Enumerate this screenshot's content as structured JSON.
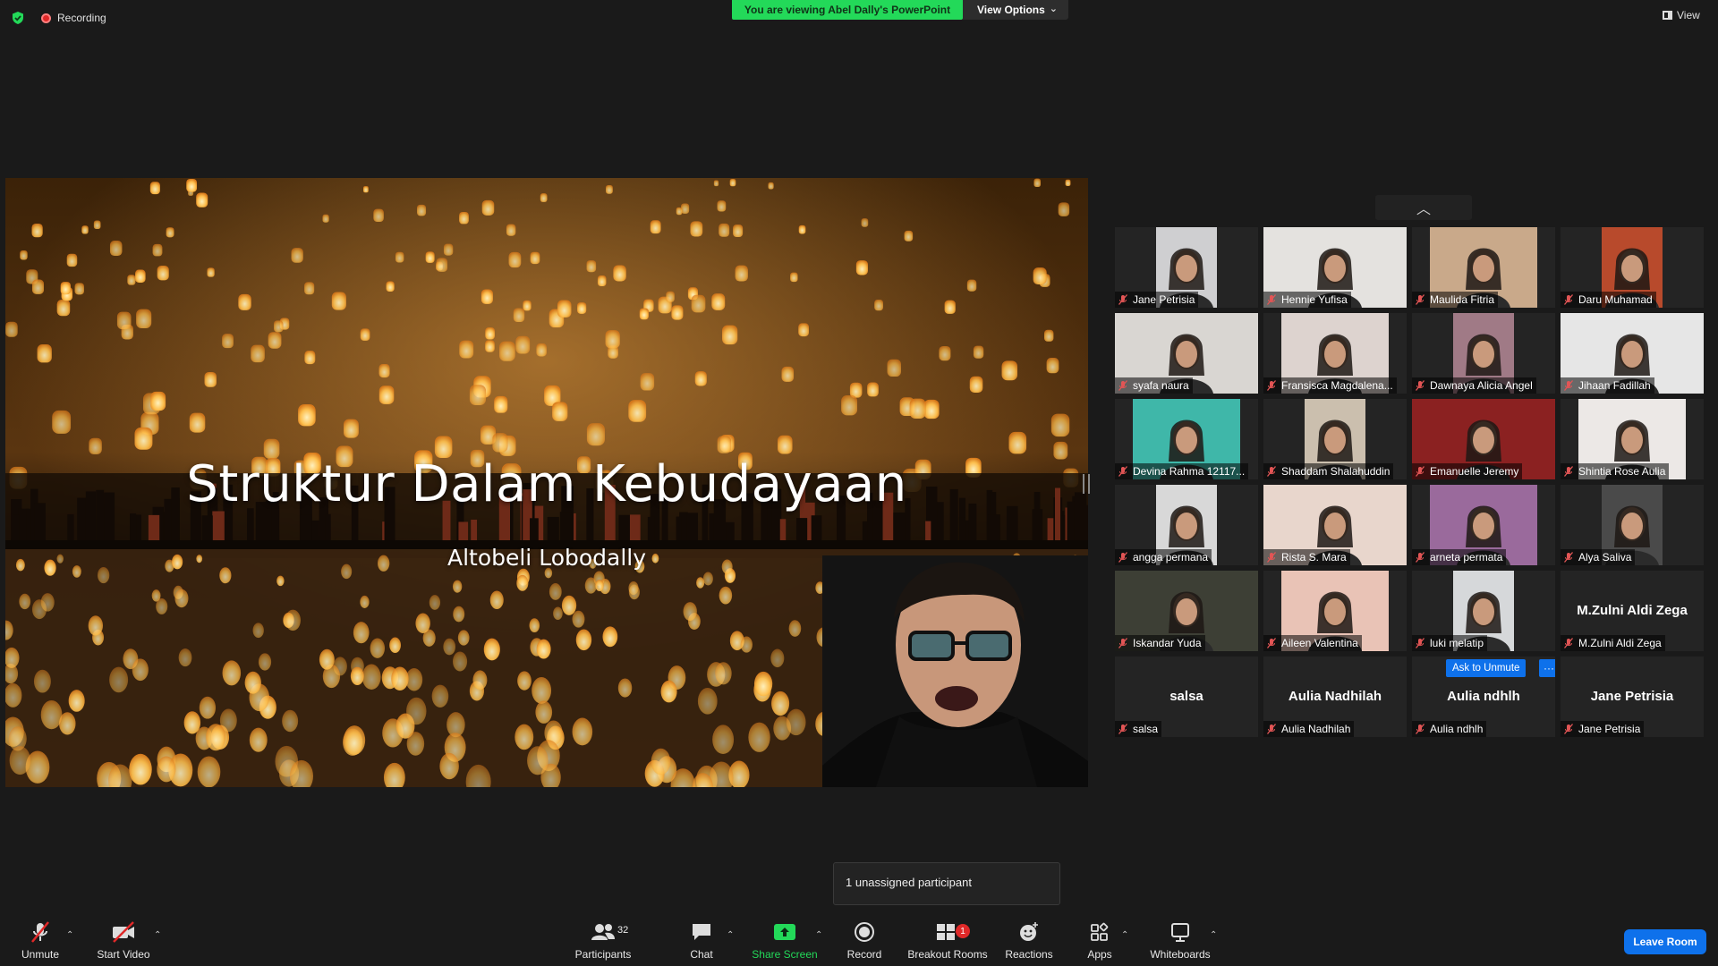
{
  "topbar": {
    "recording_label": "Recording",
    "viewing_banner": "You are viewing Abel Dally's PowerPoint",
    "view_options_label": "View Options",
    "view_label": "View"
  },
  "slide": {
    "title": "Struktur Dalam Kebudayaan",
    "subtitle": "Altobeli Lobodally"
  },
  "gallery": {
    "tiles": [
      {
        "name": "Jane Petrisia",
        "video": true,
        "bg": "#cfcfd1"
      },
      {
        "name": "Hennie Yufisa",
        "video": true,
        "bg": "#e4e2df"
      },
      {
        "name": "Maulida Fitria",
        "video": true,
        "bg": "#c9a98a"
      },
      {
        "name": "Daru Muhamad",
        "video": true,
        "bg": "#b84a2c"
      },
      {
        "name": "syafa naura",
        "video": true,
        "bg": "#d9d6d2"
      },
      {
        "name": "Fransisca Magdalena...",
        "video": true,
        "bg": "#ddd3cf"
      },
      {
        "name": "Dawnaya Alicia Angel",
        "video": true,
        "bg": "#a07a86"
      },
      {
        "name": "Jihaan Fadillah",
        "video": true,
        "bg": "#e6e6e6"
      },
      {
        "name": "Devina Rahma 12117...",
        "video": true,
        "bg": "#3fb7a9"
      },
      {
        "name": "Shaddam Shalahuddin",
        "video": true,
        "bg": "#cbbfae"
      },
      {
        "name": "Emanuelle Jeremy",
        "video": true,
        "bg": "#8b2121"
      },
      {
        "name": "Shintia Rose Aulia",
        "video": true,
        "bg": "#ece8e6"
      },
      {
        "name": "angga permana",
        "video": true,
        "bg": "#d8d8d8"
      },
      {
        "name": "Rista S. Mara",
        "video": true,
        "bg": "#e8d6cc"
      },
      {
        "name": "arneta permata",
        "video": true,
        "bg": "#9a6a9c"
      },
      {
        "name": "Alya Saliva",
        "video": true,
        "bg": "#4a4a4a"
      },
      {
        "name": "Iskandar Yuda",
        "video": true,
        "bg": "#3d3f35"
      },
      {
        "name": "Aileen Valentina",
        "video": true,
        "bg": "#e9c3b6"
      },
      {
        "name": "luki melatip",
        "video": true,
        "bg": "#d6d8da"
      },
      {
        "name": "M.Zulni Aldi Zega",
        "video": false,
        "display": "M.Zulni Aldi Zega"
      },
      {
        "name": "salsa",
        "video": false,
        "display": "salsa"
      },
      {
        "name": "Aulia Nadhilah",
        "video": false,
        "display": "Aulia Nadhilah"
      },
      {
        "name": "Aulia ndhlh",
        "video": false,
        "display": "Aulia ndhlh"
      },
      {
        "name": "Jane Petrisia",
        "video": false,
        "display": "Jane Petrisia"
      }
    ],
    "ask_to_unmute_label": "Ask to Unmute",
    "more_label": "···"
  },
  "tooltip": {
    "unassigned": "1 unassigned participant"
  },
  "toolbar": {
    "unmute": "Unmute",
    "start_video": "Start Video",
    "participants": "Participants",
    "participants_count": "32",
    "chat": "Chat",
    "share_screen": "Share Screen",
    "record": "Record",
    "breakout_rooms": "Breakout Rooms",
    "breakout_badge": "1",
    "reactions": "Reactions",
    "apps": "Apps",
    "whiteboards": "Whiteboards",
    "leave_room": "Leave Room"
  },
  "colors": {
    "accent_green": "#23d959",
    "accent_blue": "#0e71eb",
    "muted_red": "#e02828",
    "background": "#1a1a1a"
  }
}
